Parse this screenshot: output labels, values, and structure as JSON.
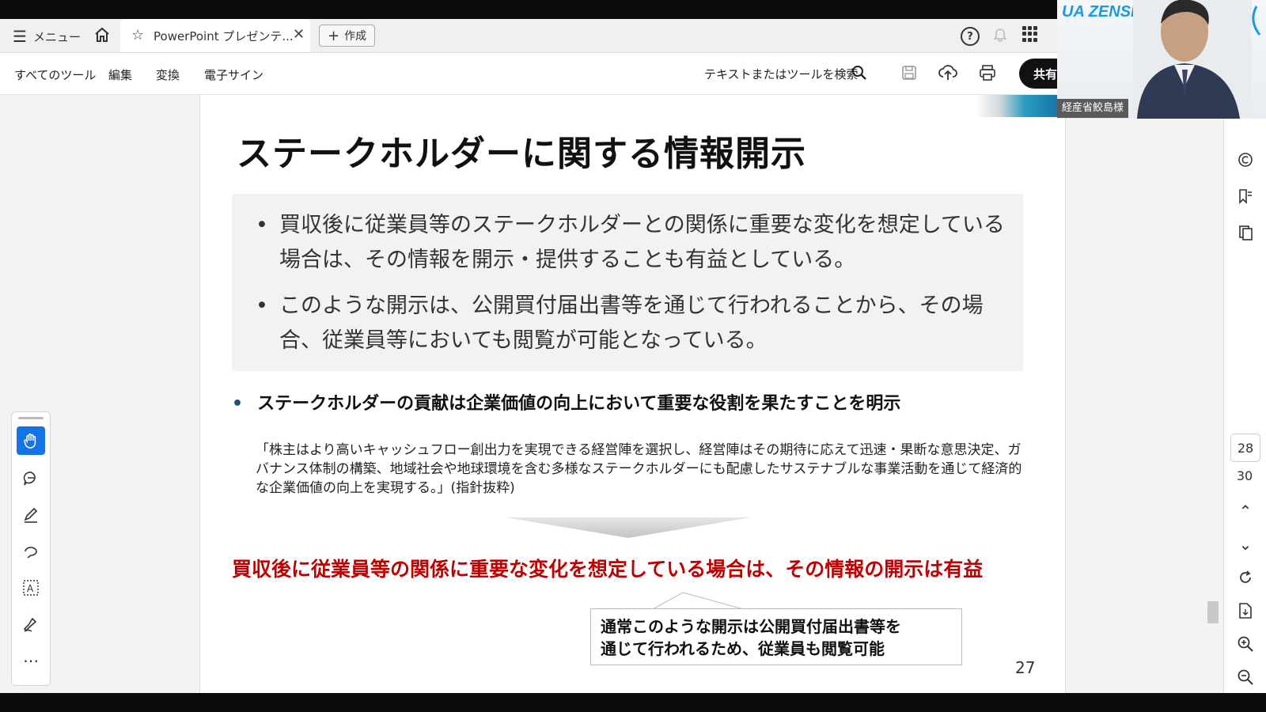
{
  "tabbar": {
    "menu_label": "メニュー",
    "tab_title": "PowerPoint プレゼンテ...",
    "create_label": "作成"
  },
  "toolbar": {
    "items": [
      "すべてのツール",
      "編集",
      "変換",
      "電子サイン"
    ],
    "search_label": "テキストまたはツールを検索",
    "share_label": "共有"
  },
  "slide": {
    "title": "ステークホルダーに関する情報開示",
    "bullets": [
      "買収後に従業員等のステークホルダーとの関係に重要な変化を想定している場合は、その情報を開示・提供することも有益としている。",
      "このような開示は、公開買付届出書等を通じて行われることから、その場合、従業員等においても閲覧が可能となっている。"
    ],
    "bullet3": "ステークホルダーの貢献は企業価値の向上において重要な役割を果たすことを明示",
    "quote": "「株主はより高いキャッシュフロー創出力を実現できる経営陣を選択し、経営陣はその期待に応えて迅速・果断な意思決定、ガバナンス体制の構築、地域社会や地球環境を含む多様なステークホルダーにも配慮したサステナブルな事業活動を通じて経済的な企業価値の向上を実現する。」(指針抜粋)",
    "conclusion": "買収後に従業員等の関係に重要な変化を想定している場合は、その情報の開示は有益",
    "callout_line1": "通常このような開示は公開買付届出書等を",
    "callout_line2": "通じて行われるため、従業員も閲覧可能",
    "page_number": "27"
  },
  "navigation": {
    "current_page": "28",
    "total_pages": "30"
  },
  "video": {
    "brand": "UA ZENSEN",
    "participant_name": "経産省鮫島様"
  },
  "colors": {
    "conclusion_red": "#c00000",
    "hand_tool_active": "#1473e6",
    "brand_blue": "#1a9be0"
  }
}
